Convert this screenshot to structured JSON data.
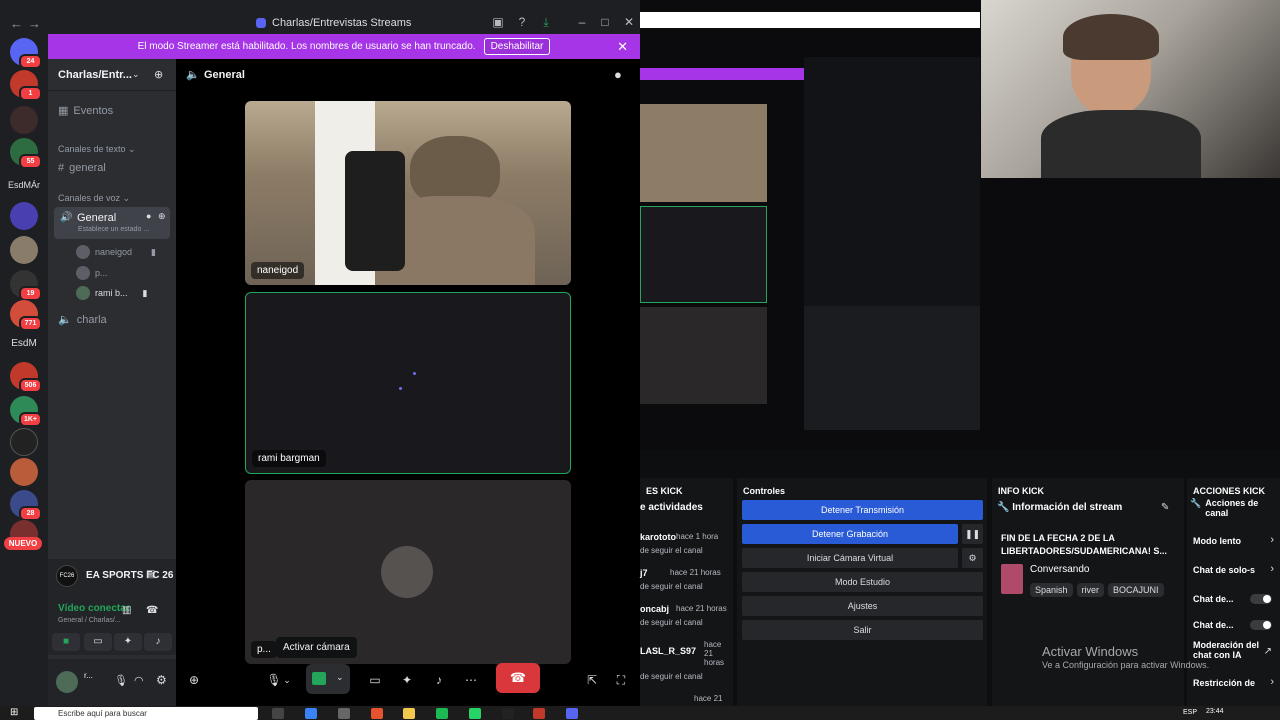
{
  "window": {
    "title": "Charlas/Entrevistas Streams",
    "streamer_notice": "El modo Streamer está habilitado. Los nombres de usuario se han truncado.",
    "streamer_disable_button": "Deshabilitar"
  },
  "rail": {
    "badges": [
      "24",
      "1",
      "55",
      "19",
      "771",
      "506",
      "1K+",
      "28"
    ],
    "labels": [
      "EsdMÁr",
      "EsdM"
    ],
    "new_label": "NUEVO"
  },
  "sidebar": {
    "server_name": "Charlas/Entr...",
    "events": "Eventos",
    "text_category": "Canales de texto",
    "text_channel": "general",
    "voice_category": "Canales de voz",
    "voice_channel_active": "General",
    "voice_status": "Establece un estado ...",
    "voice_users": [
      "naneigod",
      "p...",
      "rami b..."
    ],
    "voice_channel_2": "charla",
    "game": "EA SPORTS FC 26",
    "game_logo": "FC26",
    "voice_connected": "Vídeo conectac",
    "voice_location": "General / Charlas/...",
    "user_name": "r..."
  },
  "call": {
    "channel_title": "General",
    "tiles": [
      "naneigod",
      "rami bargman",
      "p..."
    ],
    "tooltip": "Activar cámara"
  },
  "panels": {
    "activity_header": "ES KICK",
    "activity_title": "e actividades",
    "activity": [
      {
        "user": "karototo",
        "time": "hace 1 hora",
        "sub": "de seguir el canal"
      },
      {
        "user": "j7",
        "time": "hace 21 horas",
        "sub": "de seguir el canal"
      },
      {
        "user": "oncabj",
        "time": "hace 21 horas",
        "sub": "de seguir el canal"
      },
      {
        "user": "LASL_R_S97",
        "time": "hace 21 horas",
        "sub": "de seguir el canal"
      },
      {
        "user": "",
        "time": "hace 21",
        "sub": ""
      }
    ],
    "controls_header": "Controles",
    "controls": [
      "Detener Transmisión",
      "Detener Grabación",
      "Iniciar Cámara Virtual",
      "Modo Estudio",
      "Ajustes",
      "Salir"
    ],
    "info_header": "INFO KICK",
    "info_title": "Información del stream",
    "stream_title": "FIN DE LA FECHA 2 DE LA LIBERTADORES/SUDAMERICANA! S...",
    "category": "Conversando",
    "tags": [
      "Spanish",
      "river",
      "BOCAJUNI"
    ],
    "actions_header": "ACCIONES KICK",
    "actions_title": "Acciones de canal",
    "actions": [
      "Modo lento",
      "Chat de solo-s",
      "Chat de...",
      "Chat de...",
      "Moderación del chat con IA",
      "Restricción de"
    ],
    "activate_windows": "Activar Windows",
    "activate_windows_sub": "Ve a Configuración para activar Windows."
  },
  "taskbar": {
    "search_placeholder": "Escribe aquí para buscar",
    "lang": "ESP",
    "time": "23:44"
  },
  "colors": {
    "accent": "#5865f2",
    "streamer_bar": "#a535e7",
    "online_green": "#23a55a",
    "hangup_red": "#da373c",
    "kick_blue": "#2a5bd7"
  }
}
